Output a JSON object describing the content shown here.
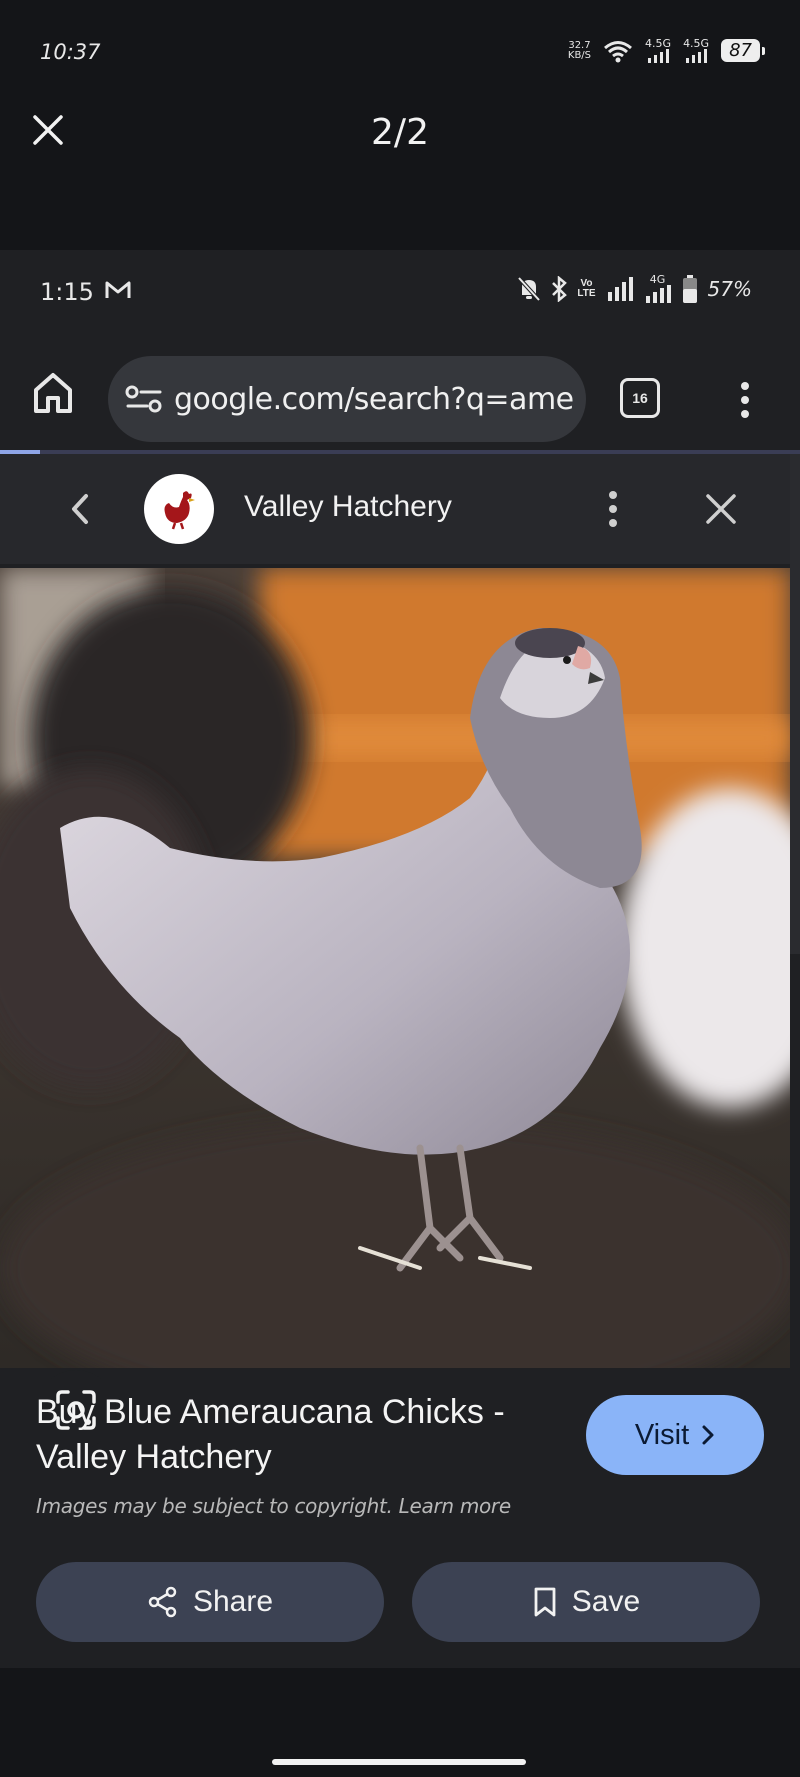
{
  "outer_status": {
    "time": "10:37",
    "speed_value": "32.7",
    "speed_unit": "KB/S",
    "net1": "4.5G",
    "net2": "4.5G",
    "battery": "87"
  },
  "viewer": {
    "counter": "2/2"
  },
  "inner_status": {
    "time": "1:15",
    "volte_top": "Vo",
    "volte_bottom": "LTE",
    "net": "4G",
    "battery": "57%"
  },
  "browser": {
    "url": "google.com/search?q=amercan",
    "tab_count": "16",
    "load_progress": 0.05
  },
  "panel": {
    "site_name": "Valley Hatchery"
  },
  "result": {
    "title": "Buy Blue Ameraucana Chicks - Valley Hatchery",
    "visit_label": "Visit",
    "copyright": "Images may be subject to copyright. Learn more",
    "share_label": "Share",
    "save_label": "Save"
  },
  "colors": {
    "accent": "#8ab4f8",
    "button_bg": "#3c4253",
    "background": "#1f2023"
  }
}
